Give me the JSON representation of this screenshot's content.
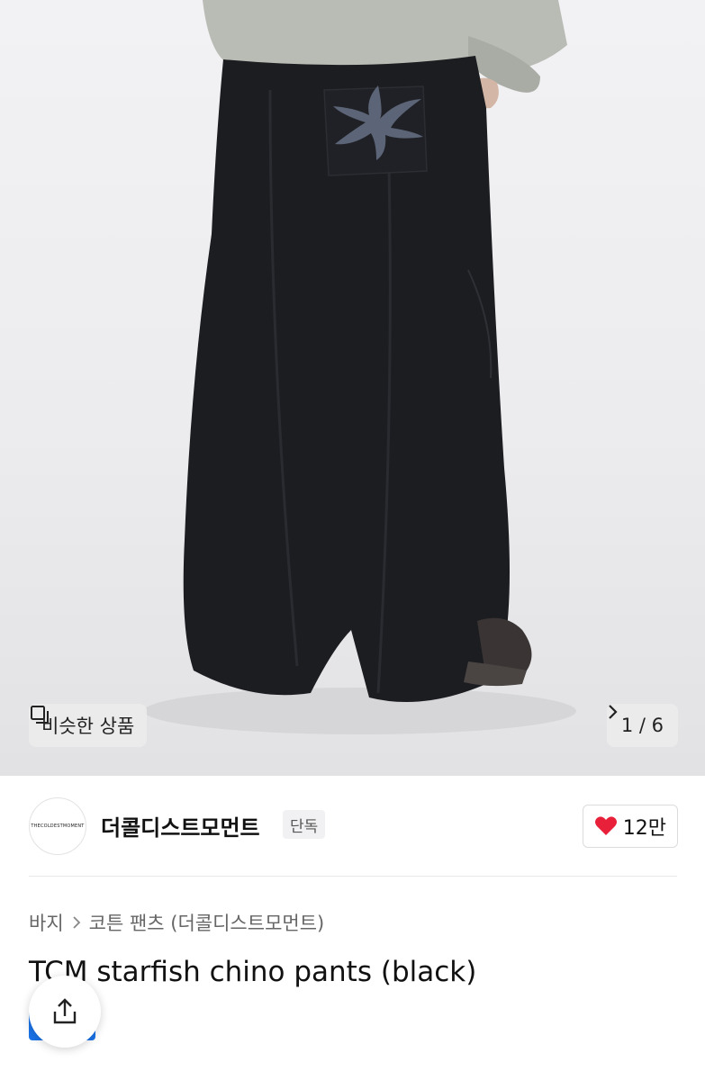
{
  "gallery": {
    "similar_label": "비슷한 상품",
    "counter": "1 / 6",
    "icons": {
      "similar": "similar-products-icon",
      "next": "chevron-right-icon"
    }
  },
  "brand": {
    "logo_text": "THECOLDESTMOMENT",
    "name": "더콜디스트모먼트",
    "badge": "단독",
    "likes": "12만",
    "like_icon_color": "#e8203a"
  },
  "breadcrumb": {
    "category": "바지",
    "subcategory": "코튼 팬츠 (더콜디스트모먼트)"
  },
  "product": {
    "title": "TCM starfish chino pants (black)"
  },
  "colors": {
    "accent_blue": "#1a73e8",
    "like_red": "#e8203a"
  }
}
